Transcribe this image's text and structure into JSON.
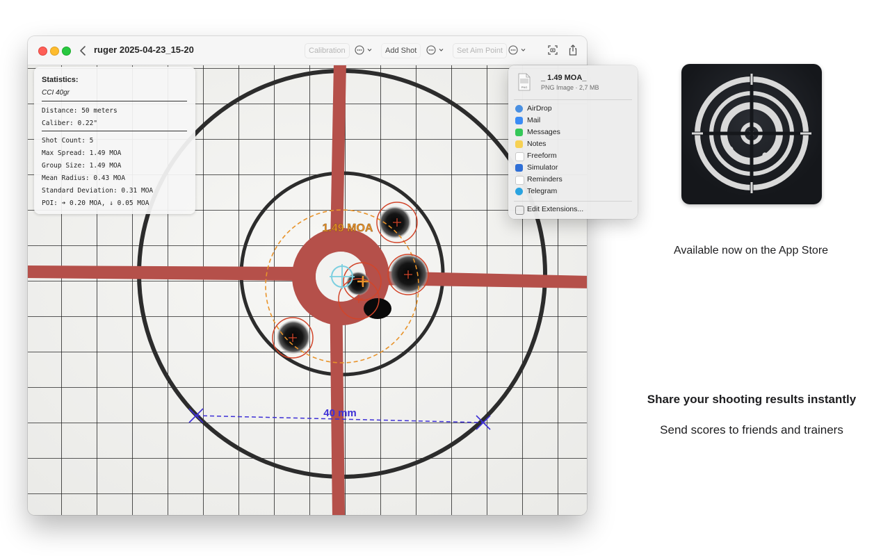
{
  "window": {
    "title": "ruger 2025-04-23_15-20",
    "toolbar": {
      "calibration": "Calibration",
      "add_shot": "Add Shot",
      "set_aim_point": "Set Aim Point"
    }
  },
  "target": {
    "group_label": "1.49 MOA",
    "scale_label": "40 mm",
    "colors": {
      "crosshair_bands": "#b5504a",
      "group_circle": "#e8932a",
      "shot_circle": "#d2452a",
      "aim_point": "#7ccfe0",
      "measure_line": "#3d2fd6"
    }
  },
  "statistics": {
    "title": "Statistics:",
    "ammo": "CCI 40gr",
    "distance": "Distance: 50 meters",
    "caliber": "Caliber: 0.22\"",
    "shot_count": "Shot Count: 5",
    "max_spread": "Max Spread: 1.49 MOA",
    "group_size": "Group Size: 1.49 MOA",
    "mean_radius": "Mean Radius: 0.43 MOA",
    "std_dev": "Standard Deviation: 0.31 MOA",
    "poi": "POI: ➔ 0.20 MOA, ↓ 0.05 MOA"
  },
  "share_menu": {
    "file_name": "_ 1.49 MOA_",
    "file_meta": "PNG Image · 2,7 MB",
    "file_badge": "PNG",
    "items": [
      {
        "label": "AirDrop",
        "icon": "airdrop-icon",
        "color": "#4a90e2"
      },
      {
        "label": "Mail",
        "icon": "mail-icon",
        "color": "#3b8cf5"
      },
      {
        "label": "Messages",
        "icon": "messages-icon",
        "color": "#35c759"
      },
      {
        "label": "Notes",
        "icon": "notes-icon",
        "color": "#f7d154"
      },
      {
        "label": "Freeform",
        "icon": "freeform-icon",
        "color": "#ffffff"
      },
      {
        "label": "Simulator",
        "icon": "simulator-icon",
        "color": "#2f6fd6"
      },
      {
        "label": "Reminders",
        "icon": "reminders-icon",
        "color": "#ffffff"
      },
      {
        "label": "Telegram",
        "icon": "telegram-icon",
        "color": "#2aa3e0"
      }
    ],
    "edit_extensions": "Edit Extensions..."
  },
  "promo": {
    "available": "Available now on the App Store",
    "headline": "Share your shooting results instantly",
    "subline": "Send scores to friends and trainers"
  }
}
